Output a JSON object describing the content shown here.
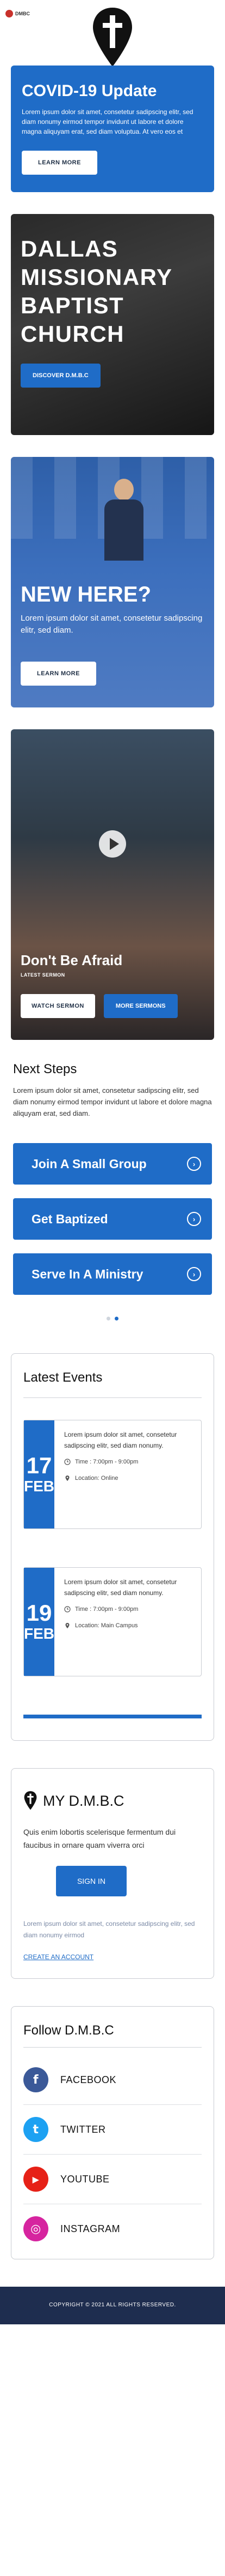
{
  "header": {
    "logo_text": "DMBC"
  },
  "covid": {
    "title": "COVID-19 Update",
    "body": "Lorem ipsum dolor sit amet, consetetur sadipscing elitr, sed diam nonumy eirmod tempor invidunt ut labore et dolore magna aliquyam erat, sed diam voluptua. At vero eos et",
    "button": "LEARN MORE"
  },
  "hero": {
    "title": "DALLAS MISSIONARY BAPTIST CHURCH",
    "button": "DISCOVER D.M.B.C"
  },
  "new_here": {
    "title": "NEW HERE?",
    "body": "Lorem ipsum dolor sit amet, consetetur sadipscing elitr, sed diam.",
    "button": "LEARN MORE"
  },
  "sermon": {
    "title": "Don't Be Afraid",
    "tag": "LATEST SERMON",
    "watch_button": "WATCH SERMON",
    "more_button": "MORE SERMONS"
  },
  "next_steps": {
    "title": "Next Steps",
    "body": "Lorem ipsum dolor sit amet, consetetur sadipscing elitr, sed diam nonumy eirmod tempor invidunt ut labore et dolore magna aliquyam erat, sed diam.",
    "items": [
      {
        "label": "Join A Small Group"
      },
      {
        "label": "Get Baptized"
      },
      {
        "label": "Serve In A Ministry"
      }
    ]
  },
  "events": {
    "title": "Latest Events",
    "items": [
      {
        "day": "17",
        "month": "FEB",
        "desc": "Lorem ipsum dolor sit amet, consetetur sadipscing elitr, sed diam nonumy.",
        "time": "Time : 7:00pm - 9:00pm",
        "location": "Location: Online"
      },
      {
        "day": "19",
        "month": "FEB",
        "desc": "Lorem ipsum dolor sit amet, consetetur sadipscing elitr, sed diam nonumy.",
        "time": "Time : 7:00pm - 9:00pm",
        "location": "Location: Main Campus"
      }
    ]
  },
  "my_dmbc": {
    "title": "MY D.M.B.C",
    "body": "Quis enim lobortis scelerisque fermentum dui faucibus in ornare quam viverra orci",
    "button": "SIGN IN",
    "faint": "Lorem ipsum dolor sit amet, consetetur sadipscing elitr, sed diam nonumy eirmod",
    "link": "CREATE AN ACCOUNT"
  },
  "follow": {
    "title": "Follow D.M.B.C",
    "items": [
      {
        "label": "FACEBOOK",
        "glyph": "f",
        "color": "#3b5998"
      },
      {
        "label": "TWITTER",
        "glyph": "t",
        "color": "#1da1f2"
      },
      {
        "label": "YOUTUBE",
        "glyph": "▶",
        "color": "#e62117"
      },
      {
        "label": "INSTAGRAM",
        "glyph": "◎",
        "color": "#d6249f"
      }
    ]
  },
  "footer": {
    "text": "COPYRIGHT © 2021 ALL RIGHTS RESERVED."
  },
  "colors": {
    "brand_blue": "#1f6cc7",
    "footer_navy": "#1e2d4f"
  }
}
